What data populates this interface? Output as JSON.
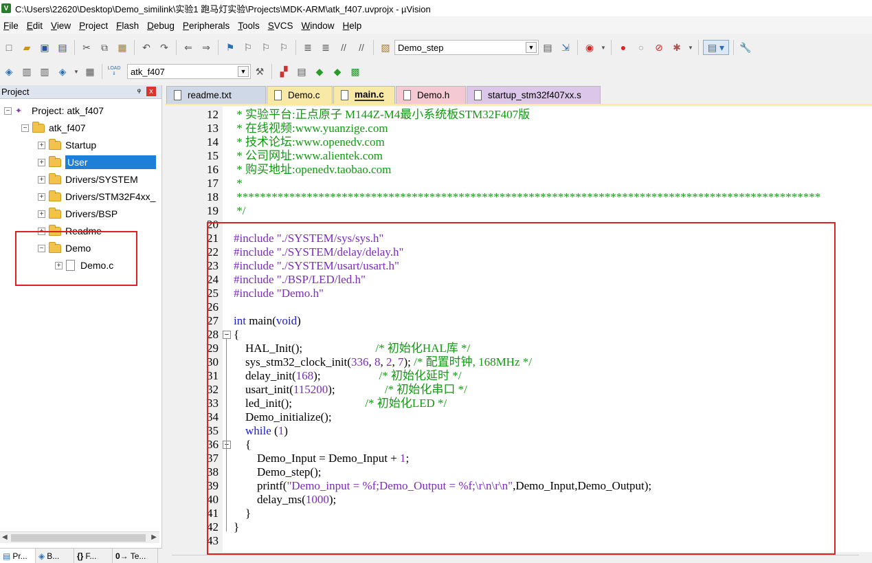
{
  "window": {
    "title": "C:\\Users\\22620\\Desktop\\Demo_similink\\实验1 跑马灯实验\\Projects\\MDK-ARM\\atk_f407.uvprojx - µVision"
  },
  "menu": [
    {
      "label": "File",
      "key": "F",
      "rest": "ile"
    },
    {
      "label": "Edit",
      "key": "E",
      "rest": "dit"
    },
    {
      "label": "View",
      "key": "V",
      "rest": "iew"
    },
    {
      "label": "Project",
      "key": "P",
      "rest": "roject"
    },
    {
      "label": "Flash",
      "key": "F",
      "rest": "lash"
    },
    {
      "label": "Debug",
      "key": "D",
      "rest": "ebug"
    },
    {
      "label": "Peripherals",
      "key": "P",
      "rest": "eripherals"
    },
    {
      "label": "Tools",
      "key": "T",
      "rest": "ools"
    },
    {
      "label": "SVCS",
      "key": "S",
      "rest": "VCS"
    },
    {
      "label": "Window",
      "key": "W",
      "rest": "indow"
    },
    {
      "label": "Help",
      "key": "H",
      "rest": "elp"
    }
  ],
  "toolbar": {
    "find_combo_value": "Demo_step",
    "target_combo_value": "atk_f407",
    "load_label": "LOAD"
  },
  "project_panel": {
    "title": "Project",
    "pin_glyph": "ᵠ",
    "close_glyph": "x",
    "root": "Project: atk_f407",
    "target": "atk_f407",
    "groups": [
      "Startup",
      "User",
      "Drivers/SYSTEM",
      "Drivers/STM32F4xx_",
      "Drivers/BSP",
      "Readme",
      "Demo"
    ],
    "demo_file": "Demo.c",
    "selected_group": "User"
  },
  "bottom_tabs": [
    {
      "icon": "▤",
      "label": "Pr..."
    },
    {
      "icon": "◈",
      "label": "B..."
    },
    {
      "icon": "{}",
      "label": "F..."
    },
    {
      "icon": "0→",
      "label": "Te..."
    }
  ],
  "tabs": [
    {
      "label": "readme.txt",
      "color": "#cfd8e6"
    },
    {
      "label": "Demo.c",
      "color": "#f8e9a6"
    },
    {
      "label": "main.c",
      "color": "#f8e9a6"
    },
    {
      "label": "Demo.h",
      "color": "#f5c9d4"
    },
    {
      "label": "startup_stm32f407xx.s",
      "color": "#dcc7ea"
    }
  ],
  "active_tab": "main.c",
  "code": {
    "first_line": 12,
    "lines": [
      " * 实验平台:正点原子 M144Z-M4最小系统板STM32F407版",
      " * 在线视频:www.yuanzige.com",
      " * 技术论坛:www.openedv.com",
      " * 公司网址:www.alientek.com",
      " * 购买地址:openedv.taobao.com",
      " *",
      " ****************************************************************************************************",
      " */",
      "",
      "#include \"./SYSTEM/sys/sys.h\"",
      "#include \"./SYSTEM/delay/delay.h\"",
      "#include \"./SYSTEM/usart/usart.h\"",
      "#include \"./BSP/LED/led.h\"",
      "#include \"Demo.h\"",
      "",
      "int main(void)",
      "{",
      "    HAL_Init();                         /* 初始化HAL库 */",
      "    sys_stm32_clock_init(336, 8, 2, 7); /* 配置时钟, 168MHz */",
      "    delay_init(168);                    /* 初始化延时 */",
      "    usart_init(115200);                 /* 初始化串口 */",
      "    led_init();                         /* 初始化LED */",
      "    Demo_initialize();",
      "    while (1)",
      "    {",
      "        Demo_Input = Demo_Input + 1;",
      "        Demo_step();",
      "        printf(\"Demo_input = %f;Demo_Output = %f;\\r\\n\\r\\n\",Demo_Input,Demo_Output);",
      "        delay_ms(1000);",
      "    }",
      "}",
      ""
    ]
  },
  "colors": {
    "comment": "#119911",
    "preprocessor": "#7a2bbf",
    "keyword": "#1a1ad9",
    "selection": "#1e7fd9",
    "highlight_box": "#e02020"
  }
}
